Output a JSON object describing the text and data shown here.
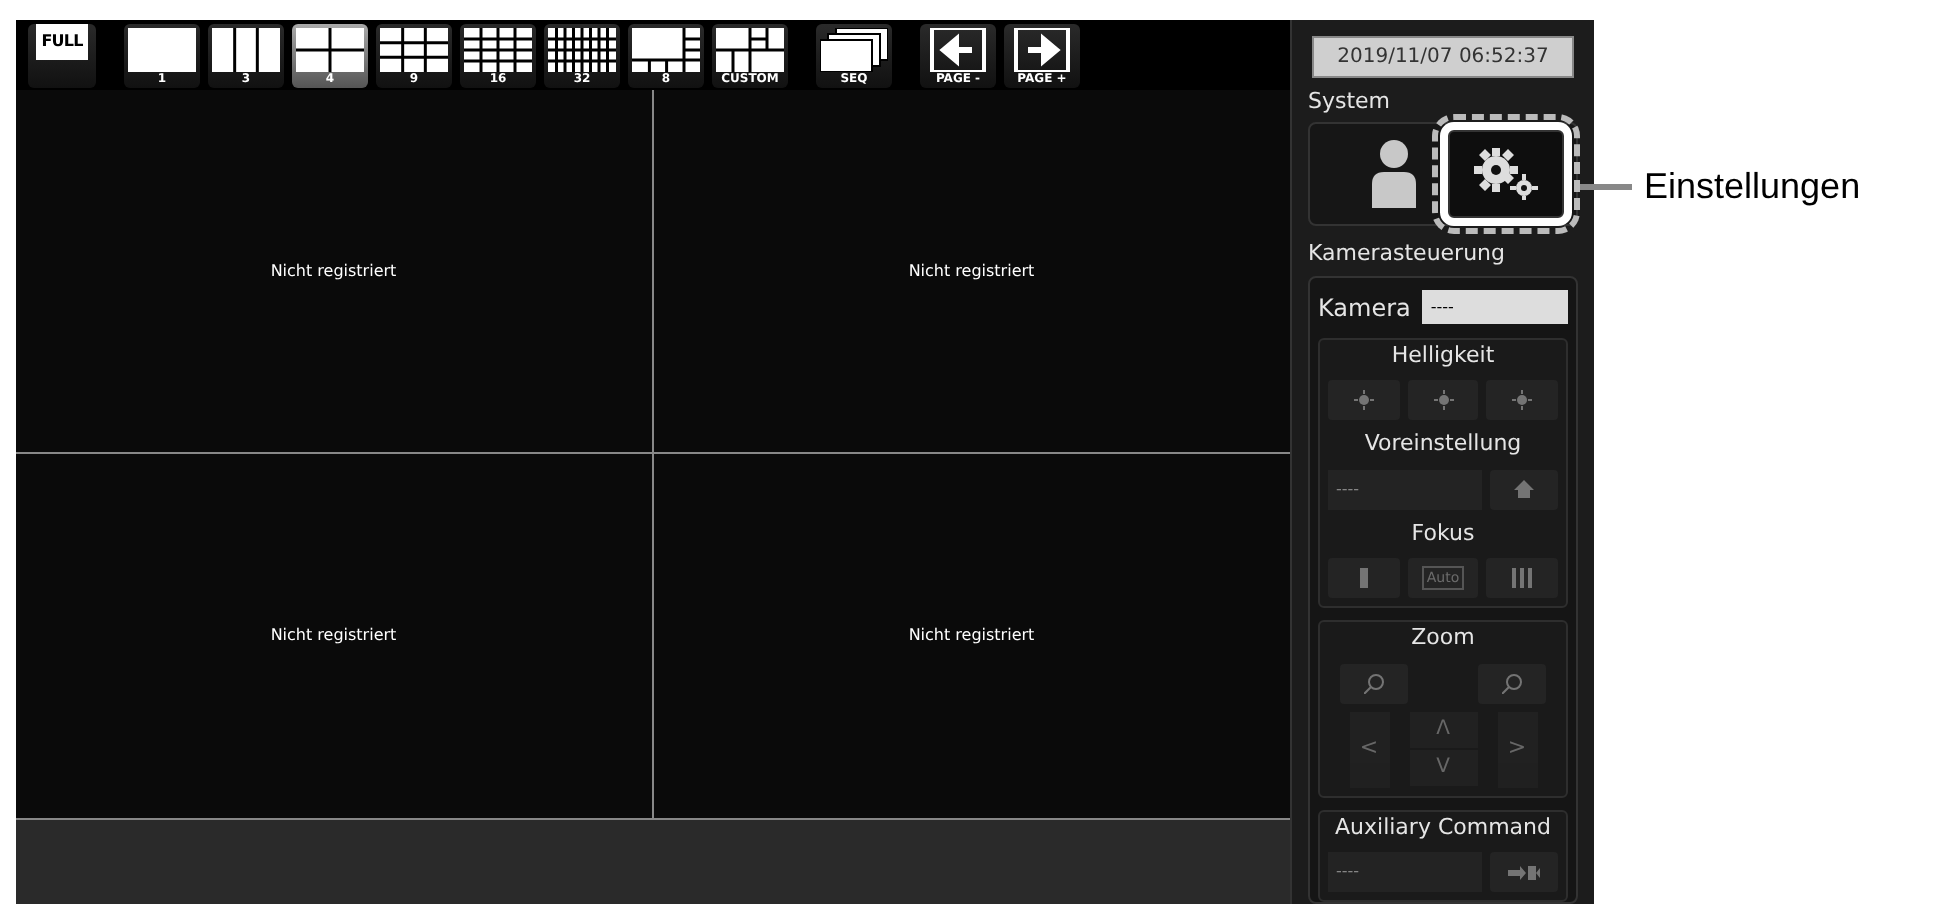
{
  "toolbar": {
    "buttons": [
      {
        "label": "FULL",
        "kind": "full",
        "selected": false
      },
      {
        "label": "1",
        "kind": "layout",
        "selected": false
      },
      {
        "label": "3",
        "kind": "layout",
        "selected": false
      },
      {
        "label": "4",
        "kind": "layout",
        "selected": true
      },
      {
        "label": "9",
        "kind": "layout",
        "selected": false
      },
      {
        "label": "16",
        "kind": "layout",
        "selected": false
      },
      {
        "label": "32",
        "kind": "layout",
        "selected": false
      },
      {
        "label": "8",
        "kind": "layout",
        "selected": false
      },
      {
        "label": "CUSTOM",
        "kind": "layout",
        "selected": false
      },
      {
        "label": "SEQ",
        "kind": "seq",
        "selected": false
      },
      {
        "label": "PAGE -",
        "kind": "page_prev",
        "selected": false
      },
      {
        "label": "PAGE +",
        "kind": "page_next",
        "selected": false
      }
    ]
  },
  "video_grid": {
    "cells": [
      {
        "status": "Nicht registriert"
      },
      {
        "status": "Nicht registriert"
      },
      {
        "status": "Nicht registriert"
      },
      {
        "status": "Nicht registriert"
      }
    ]
  },
  "panel": {
    "datetime": "2019/11/07 06:52:37",
    "system": {
      "title": "System",
      "buttons": [
        {
          "kind": "user",
          "highlighted": false
        },
        {
          "kind": "settings",
          "highlighted": true
        }
      ]
    },
    "camera_control": {
      "title": "Kamerasteuerung",
      "camera_label": "Kamera",
      "camera_value": "----",
      "brightness": {
        "title": "Helligkeit",
        "disabled": true
      },
      "preset": {
        "title": "Voreinstellung",
        "value": "----",
        "disabled": true
      },
      "focus": {
        "title": "Fokus",
        "auto_label": "Auto",
        "disabled": true
      },
      "zoom": {
        "title": "Zoom",
        "disabled": true,
        "arrows": [
          "<",
          "Λ",
          "V",
          ">"
        ]
      },
      "auxiliary": {
        "title": "Auxiliary Command",
        "value": "----",
        "disabled": true
      }
    }
  },
  "callout": {
    "label": "Einstellungen"
  }
}
